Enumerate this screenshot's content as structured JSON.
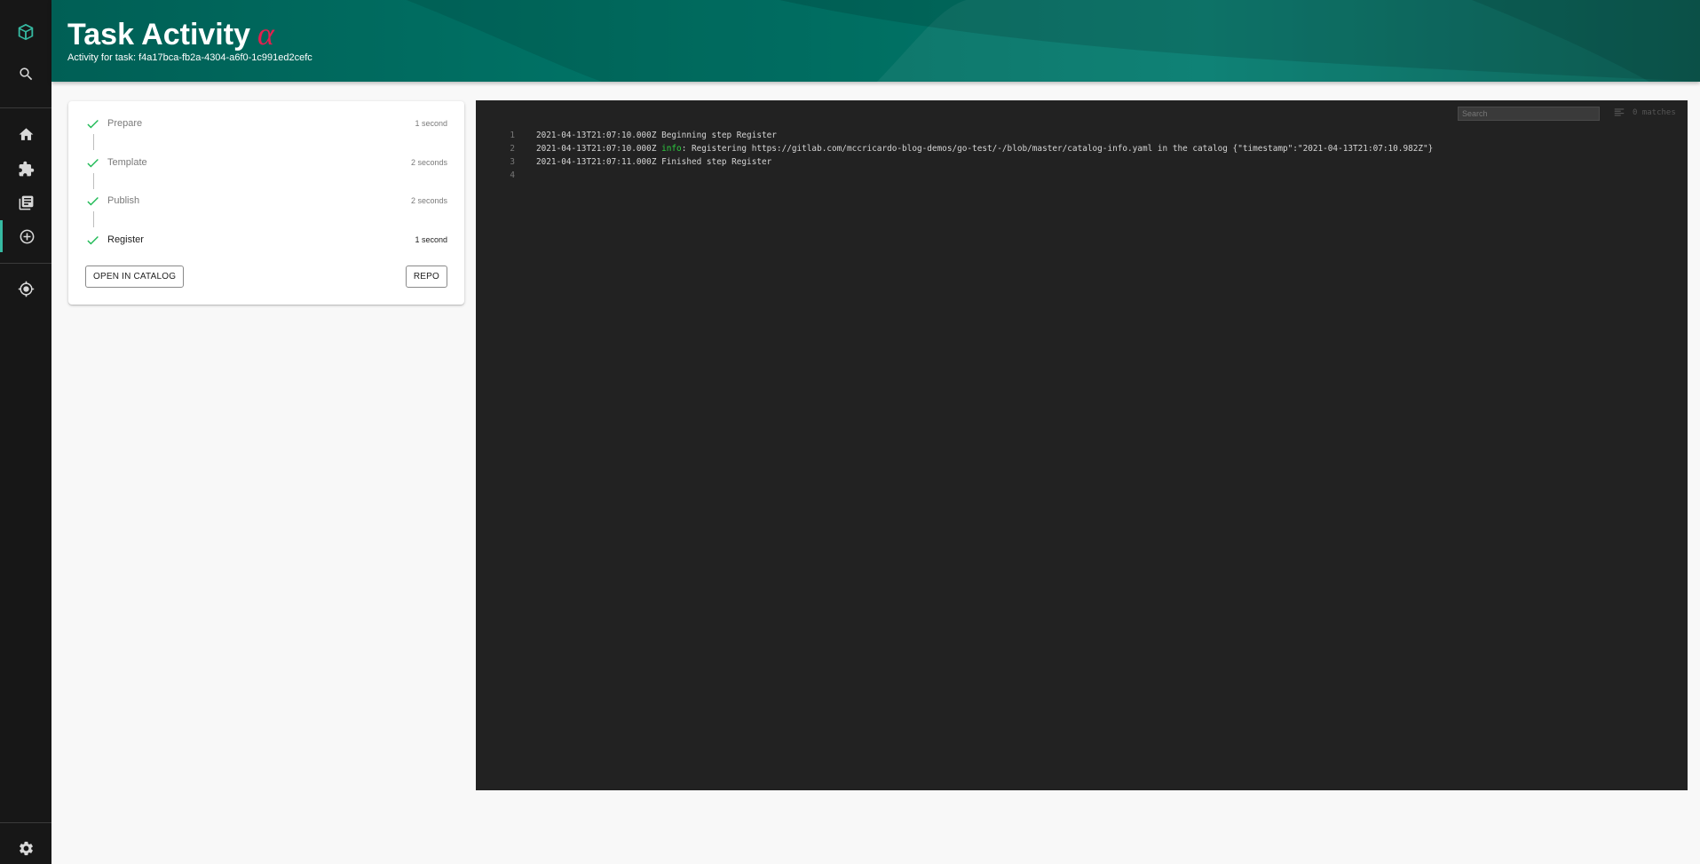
{
  "header": {
    "title": "Task Activity",
    "alpha_symbol": "α",
    "subtitle": "Activity for task: f4a17bca-fb2a-4304-a6f0-1c991ed2cefc"
  },
  "sidebar": {
    "icons": [
      "logo-icon",
      "search-icon",
      "home-icon",
      "extension-icon",
      "library-books-icon",
      "create-icon",
      "tech-radar-icon",
      "settings-icon"
    ],
    "active": "create-icon"
  },
  "steps": [
    {
      "label": "Prepare",
      "duration": "1 second"
    },
    {
      "label": "Template",
      "duration": "2 seconds"
    },
    {
      "label": "Publish",
      "duration": "2 seconds"
    },
    {
      "label": "Register",
      "duration": "1 second"
    }
  ],
  "buttons": {
    "open_in_catalog": "OPEN IN CATALOG",
    "repo": "REPO"
  },
  "log": {
    "search_placeholder": "Search",
    "matches": "0 matches",
    "lines": [
      {
        "num": "1",
        "prefix": "2021-04-13T21:07:10.000Z Beginning step Register",
        "level": "",
        "rest": ""
      },
      {
        "num": "2",
        "prefix": "2021-04-13T21:07:10.000Z ",
        "level": "info",
        "rest": ": Registering https://gitlab.com/mccricardo-blog-demos/go-test/-/blob/master/catalog-info.yaml in the catalog {\"timestamp\":\"2021-04-13T21:07:10.982Z\"}"
      },
      {
        "num": "3",
        "prefix": "2021-04-13T21:07:11.000Z Finished step Register",
        "level": "",
        "rest": ""
      },
      {
        "num": "4",
        "prefix": "",
        "level": "",
        "rest": ""
      }
    ]
  },
  "colors": {
    "sidebar_bg": "#171717",
    "header_teal": "#00796b",
    "accent": "#36baa2",
    "alpha": "#e4204f",
    "success": "#1db954",
    "log_bg": "#222222",
    "info": "#2ecc40"
  }
}
